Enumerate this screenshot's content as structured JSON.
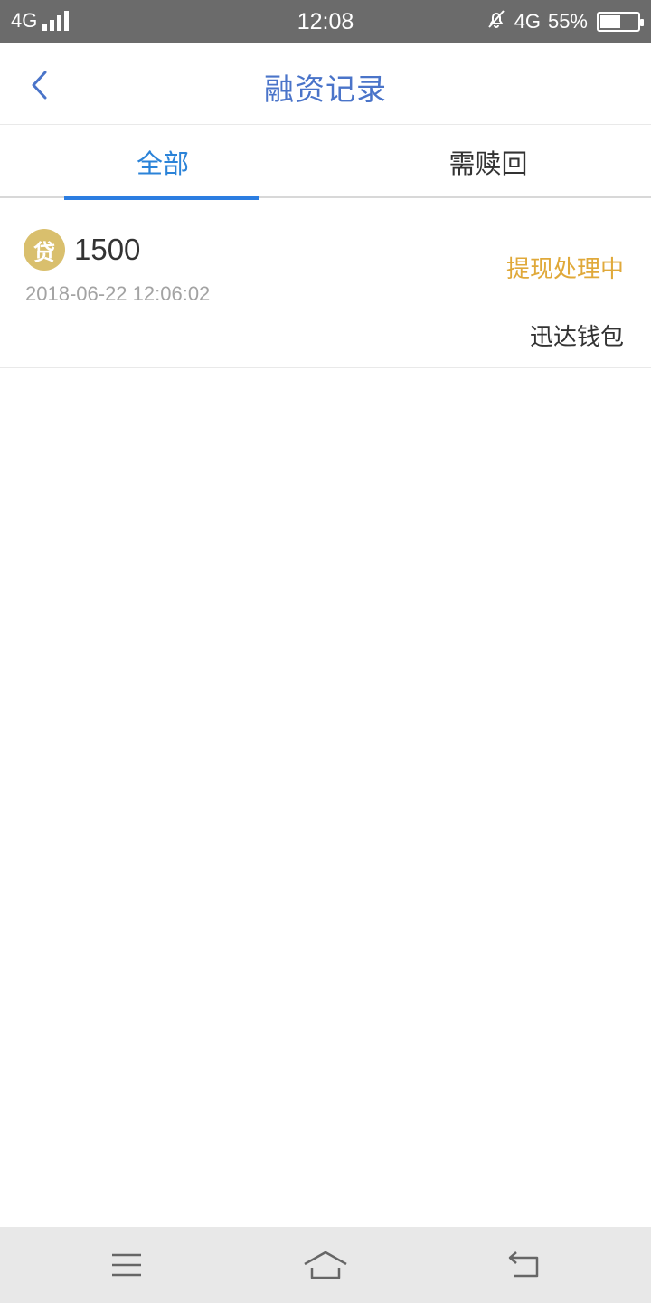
{
  "status_bar": {
    "network_left": "4G",
    "time": "12:08",
    "network_right": "4G",
    "battery_percent_text": "55%",
    "battery_level": 0.55
  },
  "header": {
    "title": "融资记录"
  },
  "tabs": [
    {
      "label": "全部",
      "active": true
    },
    {
      "label": "需赎回",
      "active": false
    }
  ],
  "records": [
    {
      "icon_label": "贷",
      "amount": "1500",
      "datetime": "2018-06-22 12:06:02",
      "status": "提现处理中",
      "wallet": "迅达钱包"
    }
  ],
  "colors": {
    "accent_blue": "#2b83d8",
    "title_blue": "#4a74c9",
    "status_orange": "#e0a93a",
    "loan_icon_gold": "#d9bf6d"
  }
}
